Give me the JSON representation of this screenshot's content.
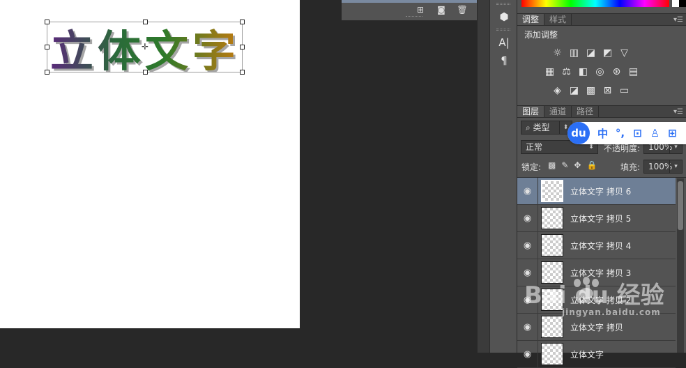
{
  "canvas": {
    "artwork_text": "立体文字"
  },
  "history_panel": {
    "icons": [
      "new-snapshot-icon",
      "camera-icon",
      "trash-icon"
    ]
  },
  "toolstrip": {
    "tools": [
      "3d-cube-icon",
      "character-icon",
      "paragraph-icon"
    ],
    "character_glyph": "A|",
    "paragraph_glyph": "¶"
  },
  "adjust_panel": {
    "tabs": [
      "调整",
      "样式"
    ],
    "active_tab": "调整",
    "title": "添加调整",
    "rows": [
      [
        "☼",
        "▥",
        "◪",
        "◩",
        "▽"
      ],
      [
        "▦",
        "⚖",
        "◧",
        "◎",
        "⊛",
        "▤"
      ],
      [
        "◈",
        "◪",
        "▩",
        "⊠",
        "▭"
      ]
    ]
  },
  "layers_panel": {
    "tabs": [
      "图层",
      "通道",
      "路径"
    ],
    "active_tab": "图层",
    "filter_label": "类型",
    "blend_mode": "正常",
    "opacity_label": "不透明度:",
    "opacity_value": "100%",
    "lock_label": "锁定:",
    "fill_label": "填充:",
    "fill_value": "100%",
    "layers": [
      {
        "name": "立体文字 拷贝 6",
        "active": true
      },
      {
        "name": "立体文字 拷贝 5",
        "active": false
      },
      {
        "name": "立体文字 拷贝 4",
        "active": false
      },
      {
        "name": "立体文字 拷贝 3",
        "active": false
      },
      {
        "name": "立体文字 拷贝 2",
        "active": false
      },
      {
        "name": "立体文字 拷贝",
        "active": false
      },
      {
        "name": "立体文字",
        "active": false
      }
    ]
  },
  "du_toolbar": {
    "logo": "du",
    "items": [
      "中",
      "°,",
      "⊡",
      "♙",
      "⊞"
    ]
  },
  "watermark": {
    "text": "Bai du 经验",
    "sub": "jingyan.baidu.com"
  }
}
